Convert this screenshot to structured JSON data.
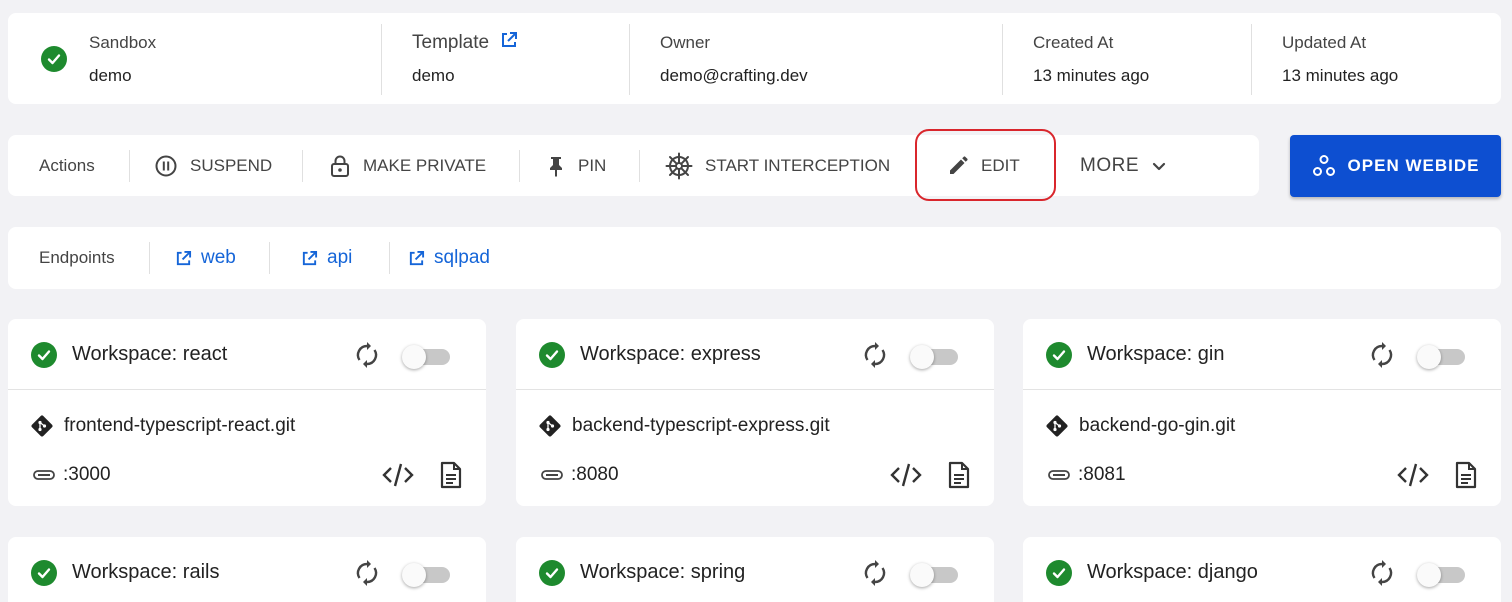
{
  "info": {
    "sandbox_label": "Sandbox",
    "sandbox_value": "demo",
    "template_label": "Template",
    "template_value": "demo",
    "owner_label": "Owner",
    "owner_value": "demo@crafting.dev",
    "created_label": "Created At",
    "created_value": "13 minutes ago",
    "updated_label": "Updated At",
    "updated_value": "13 minutes ago"
  },
  "actions": {
    "label": "Actions",
    "suspend": "SUSPEND",
    "make_private": "MAKE PRIVATE",
    "pin": "PIN",
    "start_interception": "START INTERCEPTION",
    "edit": "EDIT",
    "more": "MORE",
    "open_webide": "OPEN WEBIDE"
  },
  "endpoints": {
    "label": "Endpoints",
    "items": [
      "web",
      "api",
      "sqlpad"
    ]
  },
  "workspaces": [
    {
      "title": "Workspace: react",
      "repo": "frontend-typescript-react.git",
      "port": ":3000"
    },
    {
      "title": "Workspace: express",
      "repo": "backend-typescript-express.git",
      "port": ":8080"
    },
    {
      "title": "Workspace: gin",
      "repo": "backend-go-gin.git",
      "port": ":8081"
    },
    {
      "title": "Workspace: rails",
      "repo": "",
      "port": ""
    },
    {
      "title": "Workspace: spring",
      "repo": "",
      "port": ""
    },
    {
      "title": "Workspace: django",
      "repo": "",
      "port": ""
    }
  ],
  "colors": {
    "status_ready": "#1e8a2e",
    "primary_button": "#0d4fd1",
    "link": "#1565d8",
    "highlight": "#d9262c"
  },
  "icons": {
    "status": "check-circle-icon",
    "external_link": "external-link-icon",
    "suspend": "pause-circle-icon",
    "make_private": "lock-icon",
    "pin": "pin-icon",
    "interception": "helm-wheel-icon",
    "edit": "pencil-icon",
    "more": "chevron-down-icon",
    "open_webide": "webide-icon",
    "sync": "sync-icon",
    "git": "git-icon",
    "port": "port-icon",
    "code": "code-icon",
    "logs": "document-icon"
  }
}
